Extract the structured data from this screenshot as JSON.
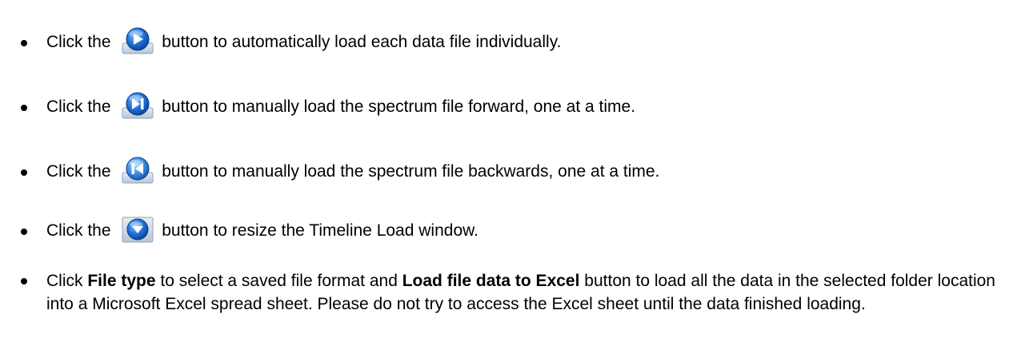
{
  "bullets": [
    {
      "prefix": "Click the",
      "icon": "play-icon",
      "suffix": "button to automatically load each data file individually."
    },
    {
      "prefix": "Click the",
      "icon": "step-forward-icon",
      "suffix": "button to manually load the spectrum file forward, one at a time."
    },
    {
      "prefix": "Click the",
      "icon": "step-backward-icon",
      "suffix": "button to manually load the spectrum file backwards, one at a time."
    },
    {
      "prefix": "Click the",
      "icon": "chevron-down-icon",
      "suffix": "button to resize the Timeline Load window."
    }
  ],
  "last_bullet": {
    "part1": "Click ",
    "bold1": "File type",
    "part2": " to select a saved file format and ",
    "bold2": "Load file data to Excel",
    "part3": " button to load all the data in the selected folder location into a Microsoft Excel spread sheet. Please do not try to access the Excel sheet until the data finished loading."
  },
  "colors": {
    "icon_blue": "#1f6fd6",
    "icon_frame": "#c9d6e3"
  }
}
